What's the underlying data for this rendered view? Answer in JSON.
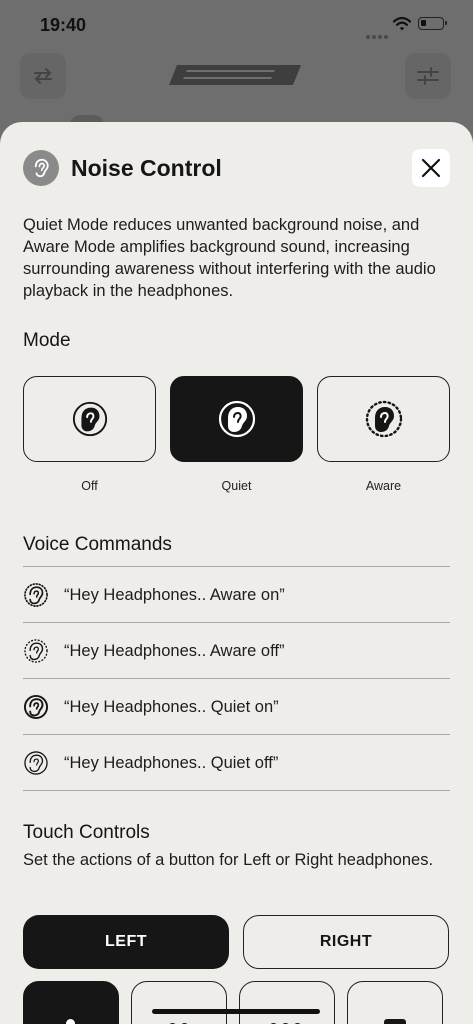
{
  "status_bar": {
    "time": "19:40"
  },
  "sheet": {
    "title": "Noise Control",
    "description": "Quiet Mode reduces unwanted background noise, and Aware Mode amplifies background sound, increasing surrounding awareness without interfering with the audio playback in the headphones.",
    "mode_heading": "Mode",
    "modes": [
      {
        "label": "Off",
        "icon": "ear-icon",
        "selected": false
      },
      {
        "label": "Quiet",
        "icon": "ear-quiet-icon",
        "selected": true
      },
      {
        "label": "Aware",
        "icon": "ear-aware-icon",
        "selected": false
      }
    ],
    "voice_heading": "Voice Commands",
    "voice_commands": [
      {
        "text": "“Hey Headphones.. Aware on”",
        "icon": "ear-aware-icon"
      },
      {
        "text": "“Hey Headphones.. Aware off”",
        "icon": "ear-aware-off-icon"
      },
      {
        "text": "“Hey Headphones.. Quiet on”",
        "icon": "ear-quiet-icon"
      },
      {
        "text": "“Hey Headphones.. Quiet off”",
        "icon": "ear-quiet-off-icon"
      }
    ],
    "touch_heading": "Touch Controls",
    "touch_sub": "Set the actions of a button for Left or Right headphones.",
    "segments": {
      "left": "LEFT",
      "right": "RIGHT",
      "selected": "left"
    }
  },
  "colors": {
    "sheet_bg": "#efedea",
    "dark": "#161616",
    "overlay": "#6e6e6e"
  }
}
